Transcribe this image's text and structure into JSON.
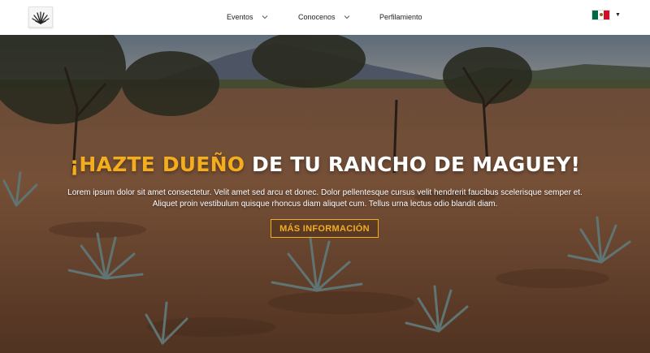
{
  "navbar": {
    "logo": {
      "icon": "agave-logo-icon"
    },
    "items": [
      {
        "label": "Eventos",
        "has_dropdown": true
      },
      {
        "label": "Conocenos",
        "has_dropdown": true
      },
      {
        "label": "Perfilamiento",
        "has_dropdown": false
      }
    ],
    "language": {
      "icon": "mexico-flag-icon",
      "dropdown_icon": "caret-down-icon"
    }
  },
  "hero": {
    "headline_part1": "¡HAZTE DUEÑO",
    "headline_part2": " DE TU RANCHO DE MAGUEY!",
    "subtext_line1": "Lorem ipsum dolor sit amet consectetur. Velit amet sed arcu et donec. Dolor pellentesque cursus velit hendrerit faucibus scelerisque semper et.",
    "subtext_line2": "Aliquet proin vestibulum quisque rhoncus diam aliquet cum. Tellus urna lectus odio blandit diam.",
    "cta_label": "MÁS INFORMACIÓN"
  },
  "colors": {
    "accent": "#f4ad1c",
    "navbar_bg": "#ffffff",
    "text_light": "#ffffff",
    "soil": "#8a5a3a",
    "agave": "#6f8c8c"
  }
}
